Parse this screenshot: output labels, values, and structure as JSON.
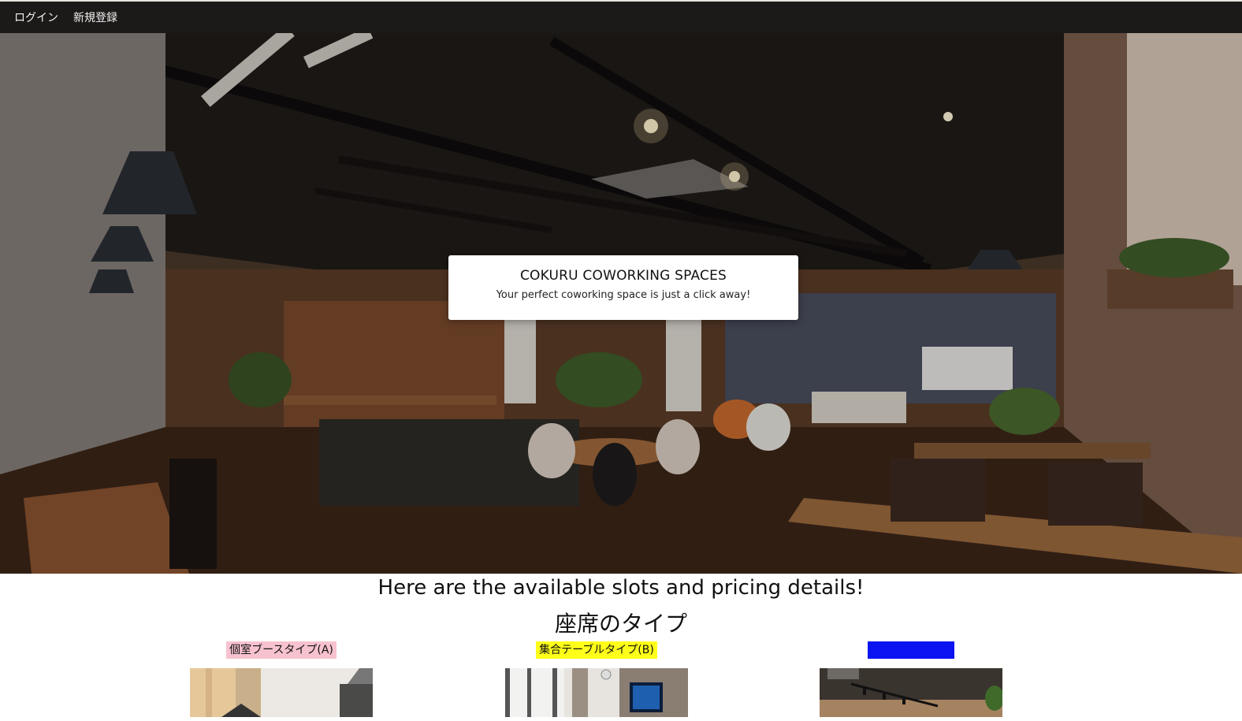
{
  "nav": {
    "login": "ログイン",
    "signup": "新規登録"
  },
  "hero": {
    "title": "COKURU COWORKING SPACES",
    "subtitle": "Your perfect coworking space is just a click away!"
  },
  "main": {
    "heading": "Here are the available slots and pricing details!",
    "seat_types_heading": "座席のタイプ",
    "seat_types": [
      {
        "label": "個室ブースタイプ(A)",
        "label_bg": "#f7c2cf"
      },
      {
        "label": "集合テーブルタイプ(B)",
        "label_bg": "#ffff1a"
      },
      {
        "label": "",
        "label_bg": "#0a14f0"
      }
    ]
  }
}
